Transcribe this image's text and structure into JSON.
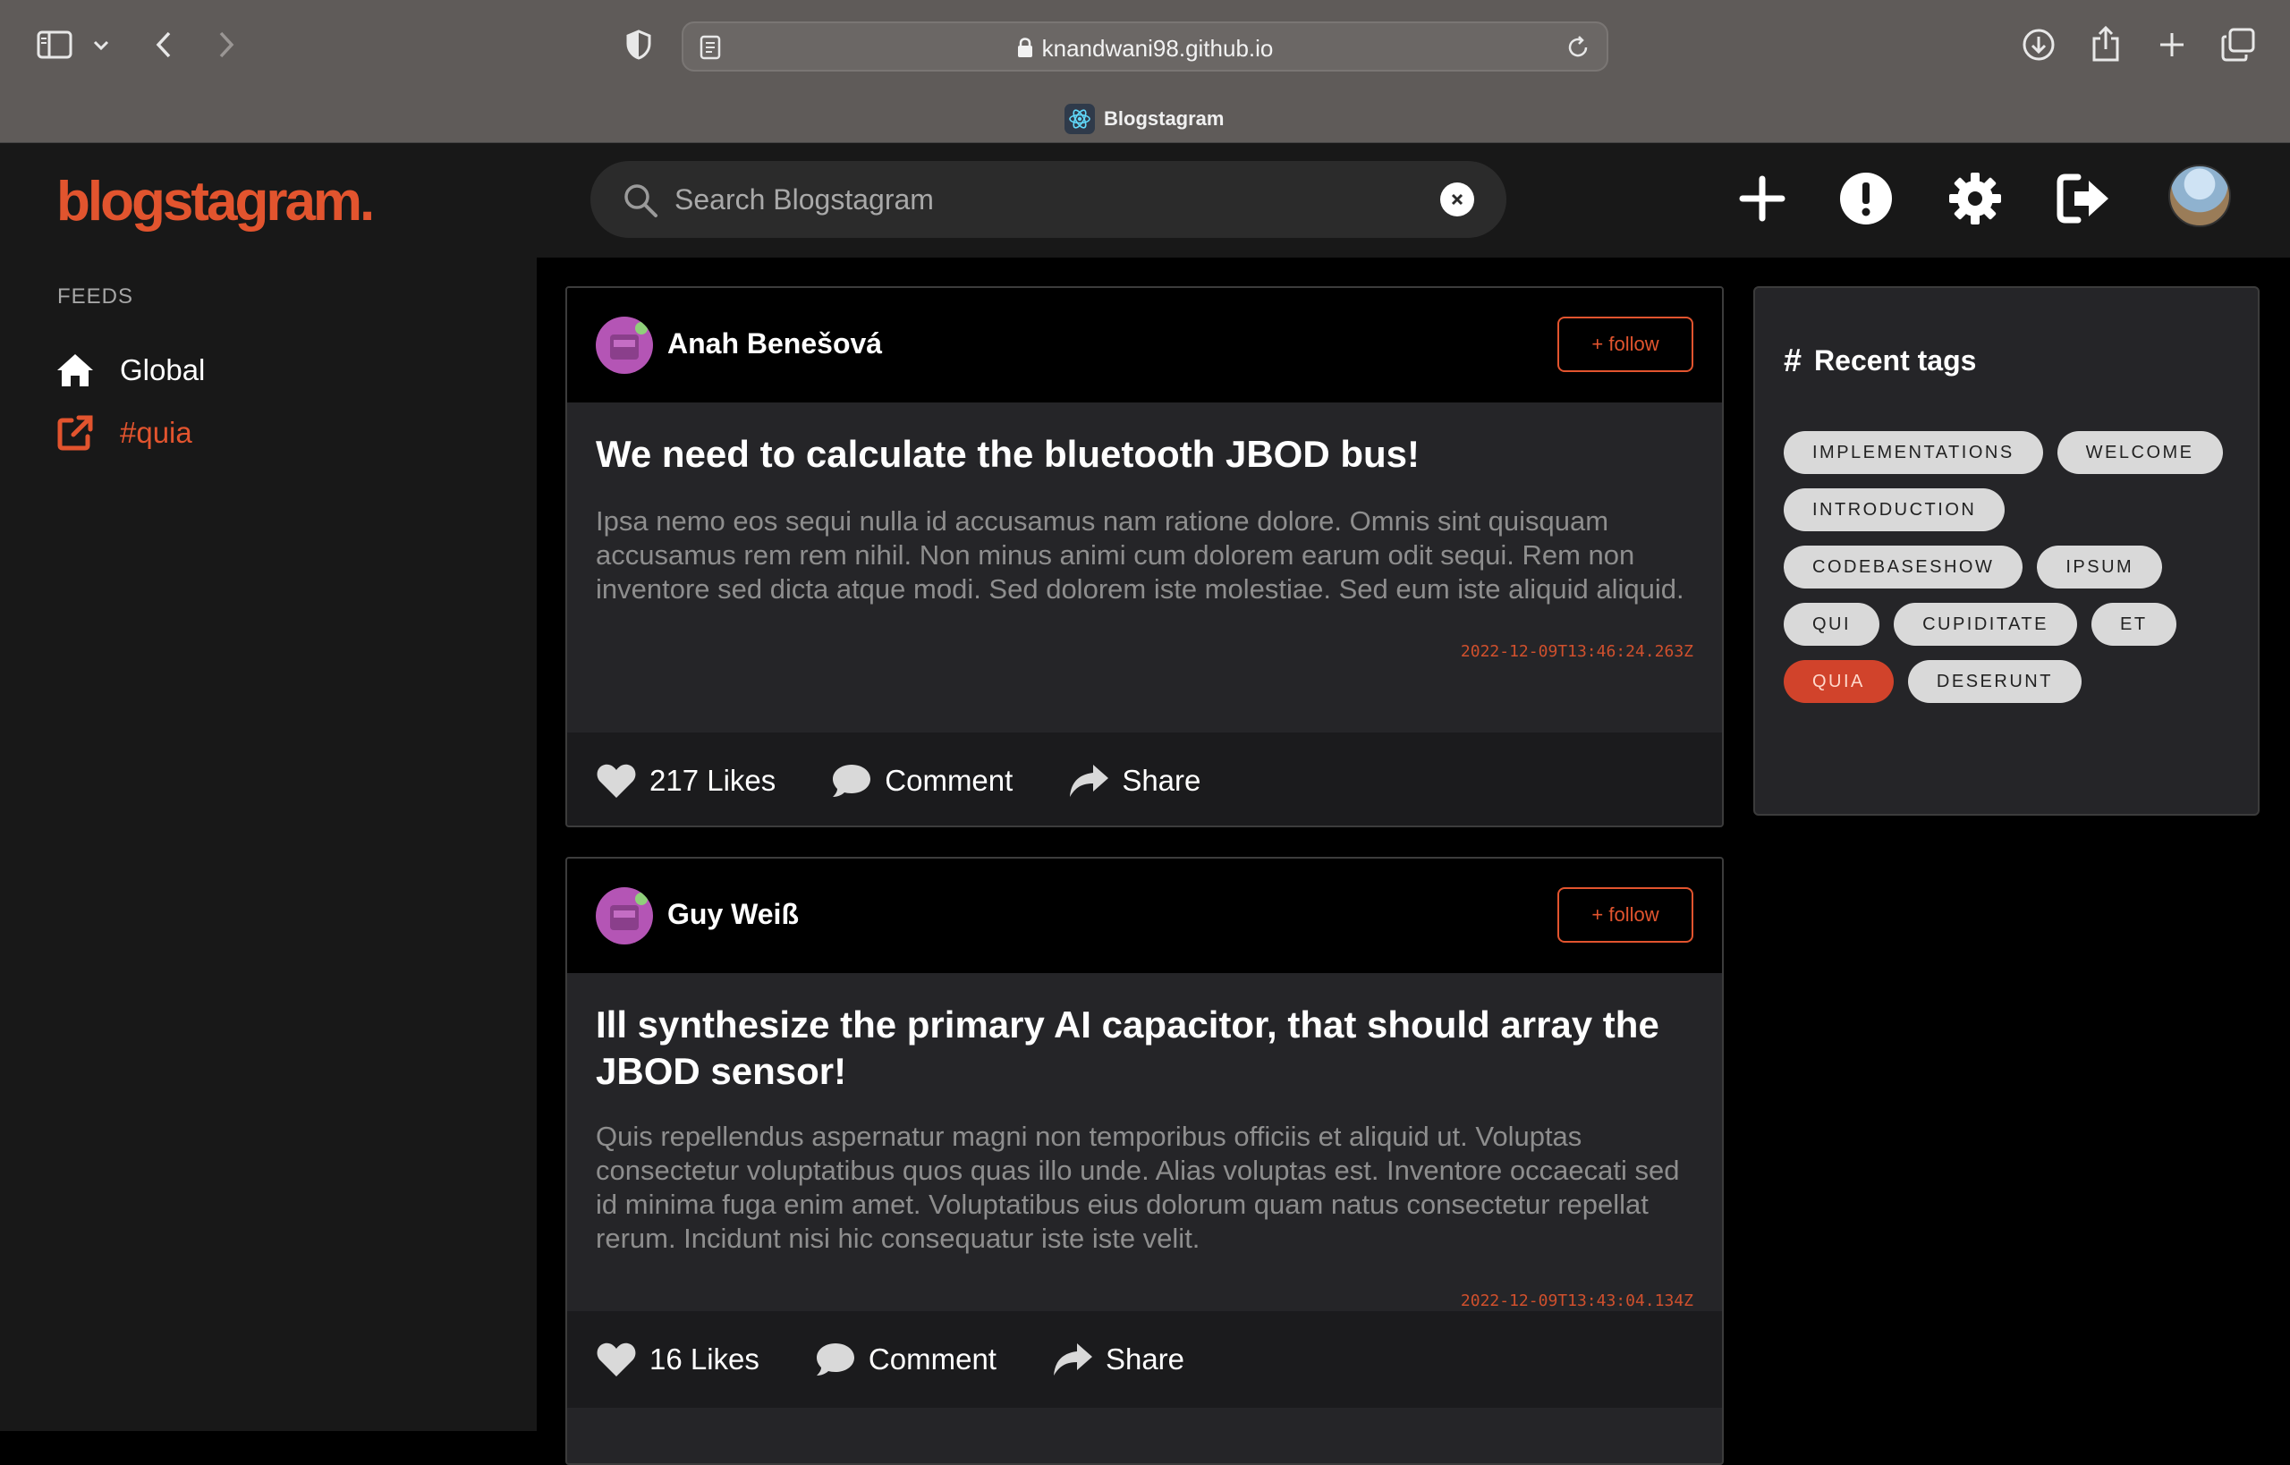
{
  "browser": {
    "url": "knandwani98.github.io",
    "tab_title": "Blogstagram"
  },
  "app": {
    "logo": "blogstagram.",
    "search_placeholder": "Search Blogstagram",
    "header_icons": [
      "plus-icon",
      "alert-icon",
      "gear-icon",
      "logout-icon"
    ]
  },
  "sidebar": {
    "heading": "FEEDS",
    "items": [
      {
        "label": "Global",
        "icon": "home-icon",
        "color": "#ffffff"
      },
      {
        "label": "#quia",
        "icon": "external-link-icon",
        "color": "#e2542e"
      }
    ]
  },
  "posts": [
    {
      "author": "Anah Benešová",
      "follow_label": "+ follow",
      "title": "We need to calculate the bluetooth JBOD bus!",
      "body": "Ipsa nemo eos sequi nulla id accusamus nam ratione dolore. Omnis sint quisquam accusamus rem rem nihil. Non minus animi cum dolorem earum odit sequi. Rem non inventore sed dicta atque modi. Sed dolorem iste molestiae. Sed eum iste aliquid aliquid.",
      "date": "2022-12-09T13:46:24.263Z",
      "likes": "217 Likes",
      "comment": "Comment",
      "share": "Share"
    },
    {
      "author": "Guy Weiß",
      "follow_label": "+ follow",
      "title": "Ill synthesize the primary AI capacitor, that should array the JBOD sensor!",
      "body": "Quis repellendus aspernatur magni non temporibus officiis et aliquid ut. Voluptas consectetur voluptatibus quos quas illo unde. Alias voluptas est. Inventore occaecati sed id minima fuga enim amet. Voluptatibus eius dolorum quam natus consectetur repellat rerum. Incidunt nisi hic consequatur iste iste velit.",
      "date": "2022-12-09T13:43:04.134Z",
      "likes": "16 Likes",
      "comment": "Comment",
      "share": "Share"
    }
  ],
  "tags_panel": {
    "title": "Recent tags",
    "tags": [
      {
        "label": "IMPLEMENTATIONS",
        "active": false
      },
      {
        "label": "WELCOME",
        "active": false
      },
      {
        "label": "INTRODUCTION",
        "active": false
      },
      {
        "label": "CODEBASESHOW",
        "active": false
      },
      {
        "label": "IPSUM",
        "active": false
      },
      {
        "label": "QUI",
        "active": false
      },
      {
        "label": "CUPIDITATE",
        "active": false
      },
      {
        "label": "ET",
        "active": false
      },
      {
        "label": "QUIA",
        "active": true
      },
      {
        "label": "DESERUNT",
        "active": false
      }
    ]
  },
  "colors": {
    "accent": "#e2542e",
    "background": "#000000",
    "panel": "#252528"
  }
}
